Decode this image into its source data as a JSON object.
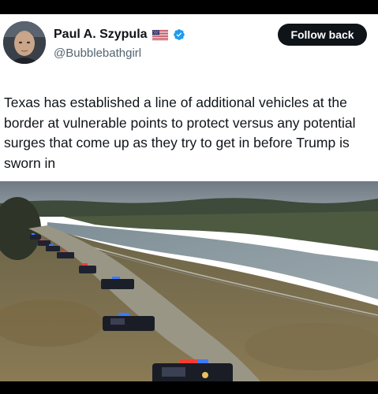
{
  "author": {
    "display_name": "Paul A. Szypula",
    "handle": "@Bubblebathgirl"
  },
  "icons": {
    "avatar": "avatar-photo",
    "flag": "us-flag-icon",
    "verified": "verified-badge-icon"
  },
  "follow_button": {
    "label": "Follow back"
  },
  "tweet": {
    "text": "Texas has established a line of additional vehicles at the border at vulnerable points to protect versus any potential surges that come up as they try to get in before Trump is sworn in"
  },
  "media": {
    "description_icon": "photo-river-border-vehicles"
  },
  "colors": {
    "button_bg": "#0f1419",
    "verified": "#1d9bf0",
    "text": "#0f1419",
    "handle": "#536471"
  }
}
